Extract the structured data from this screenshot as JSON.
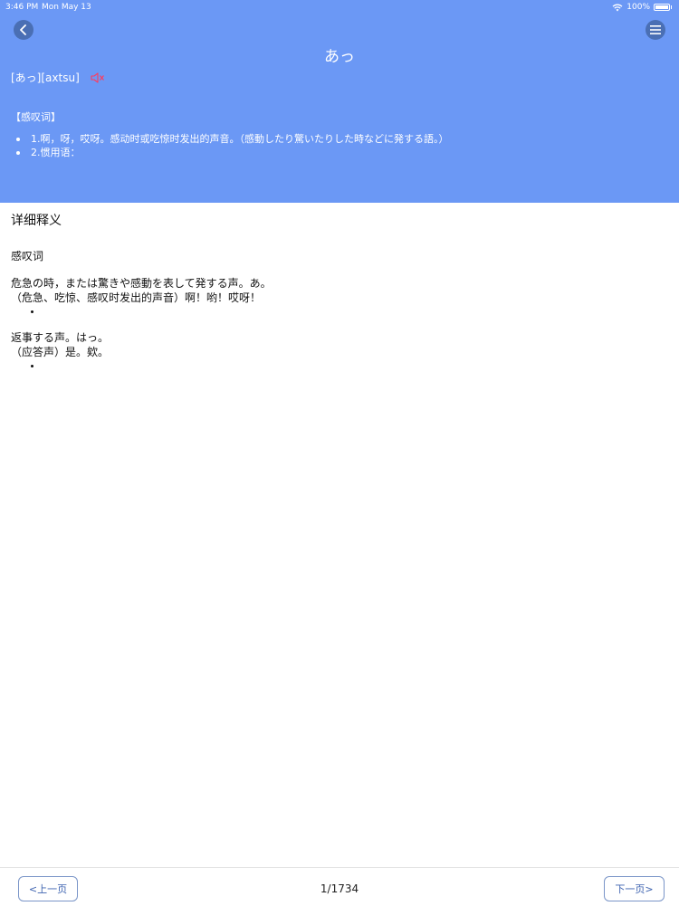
{
  "status": {
    "time": "3:46 PM",
    "date": "Mon May 13",
    "battery": "100%"
  },
  "header": {
    "title": "あっ",
    "pronunciation": "[あっ][axtsu]",
    "part_of_speech": "【感叹词】",
    "definitions": [
      "1.啊，呀，哎呀。感动时或吃惊时发出的声音。（感動したり驚いたりした時などに発する語。）",
      "2.惯用语："
    ],
    "accent_color": "#6b98f5",
    "speaker_color": "#ff3b5c"
  },
  "detail": {
    "section_title": "详细释义",
    "part_of_speech": "感叹词",
    "entries": [
      {
        "jp": "危急の時，または驚きや感動を表して発する声。あ。",
        "cn": "（危急、吃惊、感叹时发出的声音）啊！哟！哎呀！"
      },
      {
        "jp": "返事する声。はっ。",
        "cn": "（应答声）是。欸。"
      }
    ]
  },
  "footer": {
    "prev_label": "<上一页",
    "next_label": "下一页>",
    "page_indicator": "1/1734"
  },
  "icons": {
    "back": "chevron-left-icon",
    "menu": "menu-icon",
    "speaker": "speaker-icon",
    "wifi": "wifi-icon",
    "battery": "battery-icon"
  }
}
